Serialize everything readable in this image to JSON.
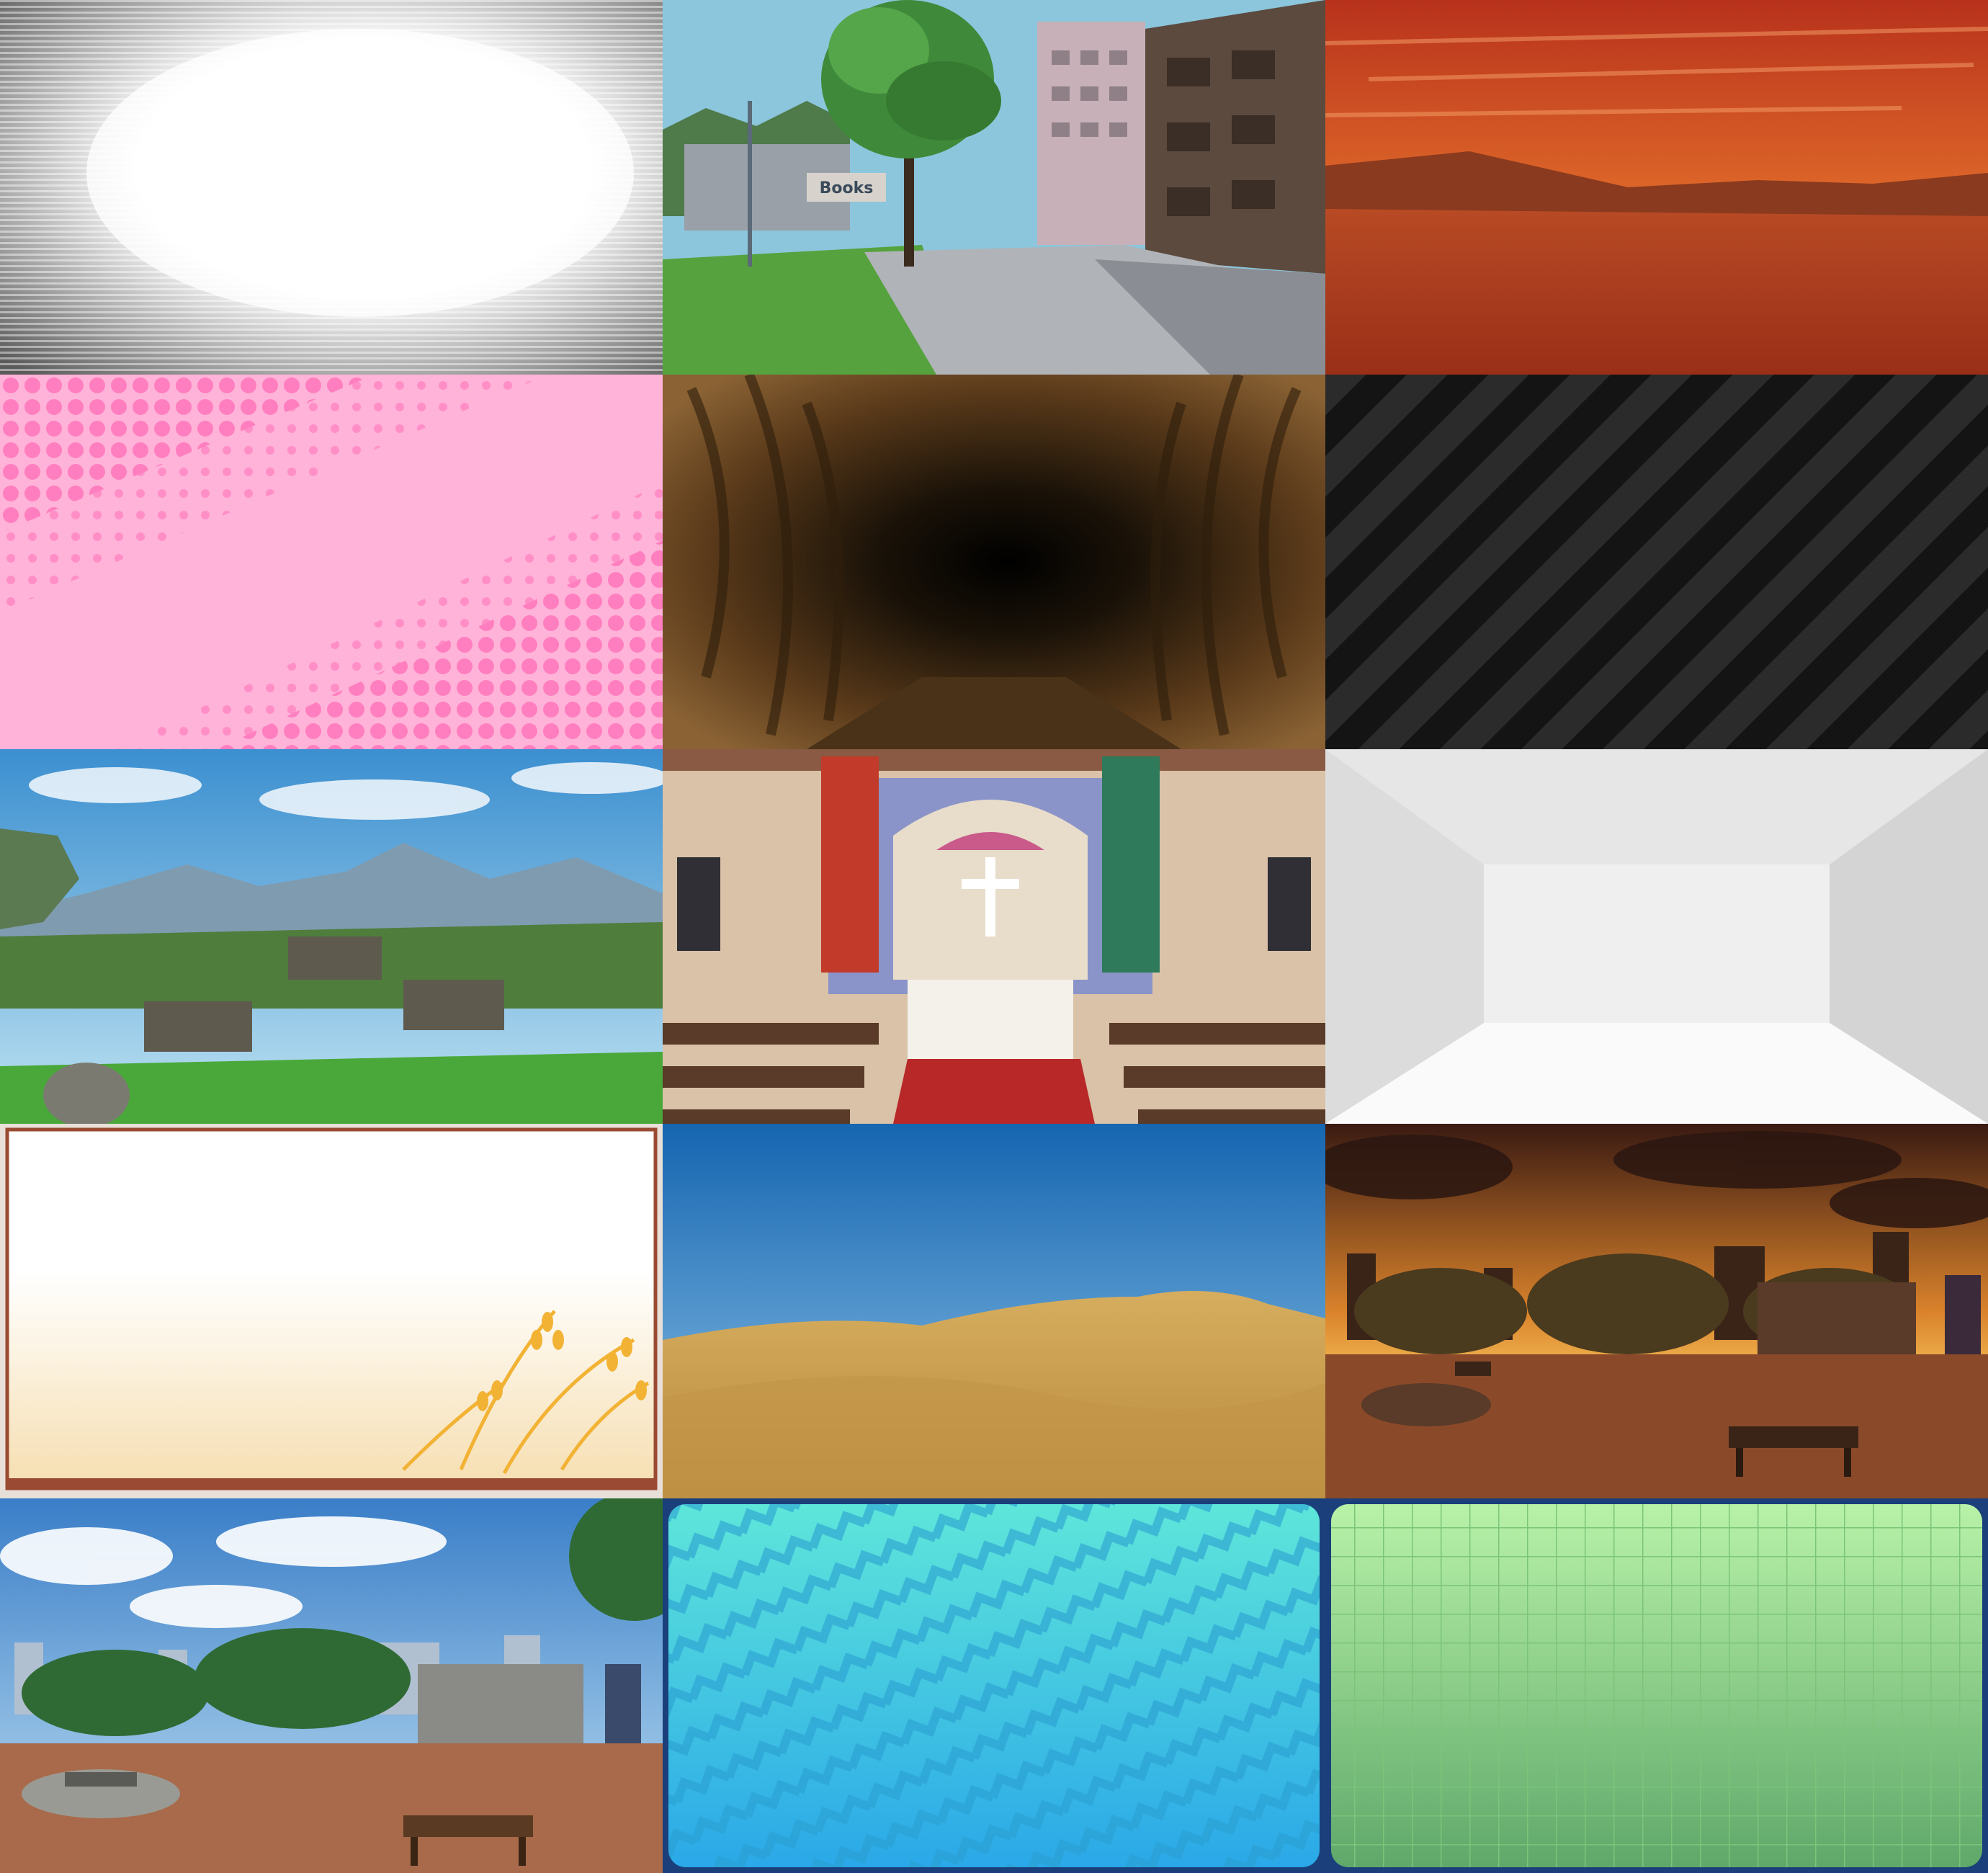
{
  "gallery": {
    "columns": 3,
    "rows": 5,
    "tiles": [
      {
        "id": "speedlines-white",
        "signage_text": ""
      },
      {
        "id": "city-street",
        "signage_text": "Books"
      },
      {
        "id": "red-sky-desert",
        "signage_text": ""
      },
      {
        "id": "pink-halftone",
        "signage_text": ""
      },
      {
        "id": "dark-tunnel",
        "signage_text": ""
      },
      {
        "id": "dark-diagonal-stripes",
        "signage_text": ""
      },
      {
        "id": "grassy-mountain-valley",
        "signage_text": ""
      },
      {
        "id": "church-interior",
        "signage_text": ""
      },
      {
        "id": "white-empty-room",
        "signage_text": ""
      },
      {
        "id": "framed-card-wheat",
        "signage_text": ""
      },
      {
        "id": "sand-dunes-blue-sky",
        "signage_text": ""
      },
      {
        "id": "park-sunset",
        "signage_text": ""
      },
      {
        "id": "park-daytime",
        "signage_text": ""
      },
      {
        "id": "teal-zigzag-panel",
        "signage_text": ""
      },
      {
        "id": "green-grid-panel",
        "signage_text": ""
      }
    ]
  },
  "colors": {
    "pink": "#ff8cc6",
    "sunset_orange": "#d9822b",
    "desert_red": "#a8391e",
    "sand": "#c9a24f",
    "sky_blue": "#1e73b8",
    "teal": "#38c8e0",
    "grid_green": "#9fe39a"
  }
}
